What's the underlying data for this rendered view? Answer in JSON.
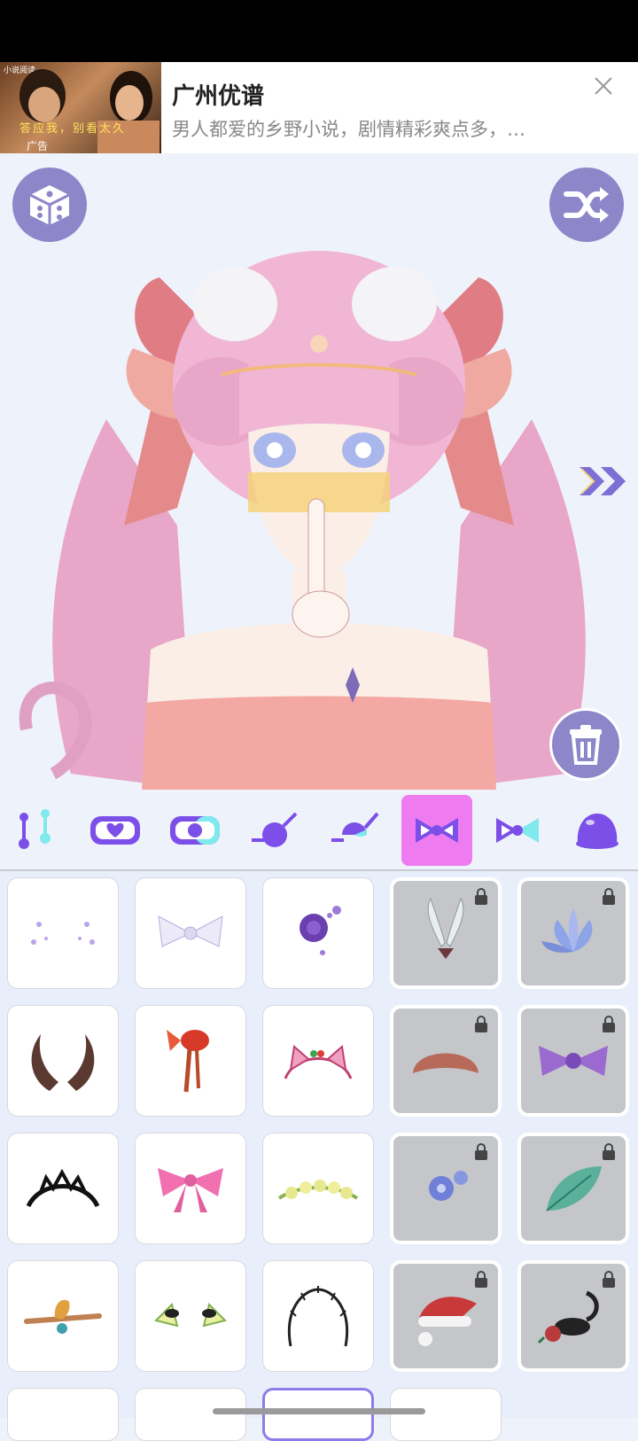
{
  "ad": {
    "thumb_tag": "小说阅读",
    "thumb_caption": "答应我，别看太久",
    "thumb_badge": "广告",
    "title": "广州优谱",
    "description": "男人都爱的乡野小说，剧情精彩爽点多，…",
    "close_icon": "close-icon"
  },
  "stage": {
    "random_button_icon": "dice-icon",
    "shuffle_button_icon": "shuffle-icon",
    "next_icon": "double-chevron-right-icon",
    "delete_button_icon": "trash-icon"
  },
  "tabs": [
    {
      "icon": "piercing-icon",
      "active": false
    },
    {
      "icon": "heart-mask-icon",
      "active": false
    },
    {
      "icon": "half-mask-icon",
      "active": false
    },
    {
      "icon": "eye-patch-icon",
      "active": false
    },
    {
      "icon": "monocle-icon",
      "active": false
    },
    {
      "icon": "bow-icon",
      "active": true
    },
    {
      "icon": "side-bow-icon",
      "active": false
    },
    {
      "icon": "hat-icon",
      "active": false
    }
  ],
  "items": [
    {
      "name": "sparkle-dots",
      "locked": false
    },
    {
      "name": "white-bow",
      "locked": false
    },
    {
      "name": "purple-rose",
      "locked": false
    },
    {
      "name": "insect-wings",
      "locked": true
    },
    {
      "name": "blue-lotus",
      "locked": true
    },
    {
      "name": "curved-horns",
      "locked": false
    },
    {
      "name": "goldfish-ornament",
      "locked": false
    },
    {
      "name": "cat-ear-headband",
      "locked": false
    },
    {
      "name": "bread-hat",
      "locked": true
    },
    {
      "name": "purple-bow",
      "locked": true
    },
    {
      "name": "black-tiara",
      "locked": false
    },
    {
      "name": "pink-bow",
      "locked": false
    },
    {
      "name": "flower-crown",
      "locked": false
    },
    {
      "name": "blue-flowers",
      "locked": true
    },
    {
      "name": "green-leaf",
      "locked": true
    },
    {
      "name": "dragon-antlers",
      "locked": false
    },
    {
      "name": "earphones",
      "locked": false
    },
    {
      "name": "thorn-tiara",
      "locked": false
    },
    {
      "name": "santa-hat",
      "locked": true
    },
    {
      "name": "scorpion-rose",
      "locked": true
    }
  ],
  "colors": {
    "accent": "#8d86c9",
    "active_tab": "#ee7cf0",
    "icon_purple": "#7b4fe8",
    "icon_cyan": "#7fe9ee"
  }
}
